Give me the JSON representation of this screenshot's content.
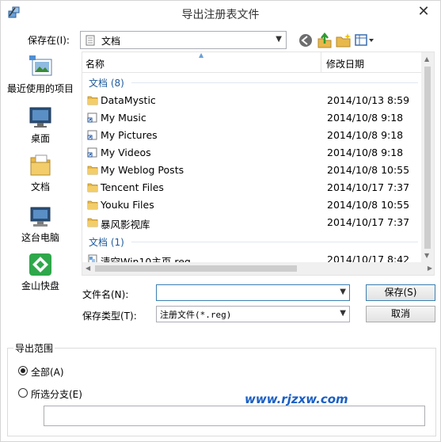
{
  "window": {
    "title": "导出注册表文件",
    "close_glyph": "✕"
  },
  "toolbar": {
    "save_in_label": "保存在(I):",
    "location": "文档",
    "back_icon": "back-arrow-icon",
    "up_icon": "up-folder-icon",
    "new_folder_icon": "new-folder-icon",
    "view_icon": "view-menu-icon"
  },
  "places": [
    {
      "label": "最近使用的项目",
      "icon": "recent-items-icon"
    },
    {
      "label": "桌面",
      "icon": "desktop-icon"
    },
    {
      "label": "文档",
      "icon": "documents-icon"
    },
    {
      "label": "这台电脑",
      "icon": "this-pc-icon"
    },
    {
      "label": "金山快盘",
      "icon": "kuaipan-icon"
    }
  ],
  "filelist": {
    "columns": {
      "name": "名称",
      "date": "修改日期"
    },
    "groups": [
      {
        "label": "文档 (8)"
      },
      {
        "label": "文档 (1)"
      }
    ],
    "rows": [
      {
        "name": "DataMystic",
        "date": "2014/10/13 8:59",
        "icon": "folder-icon"
      },
      {
        "name": "My Music",
        "date": "2014/10/8 9:18",
        "icon": "shortcut-icon"
      },
      {
        "name": "My Pictures",
        "date": "2014/10/8 9:18",
        "icon": "shortcut-icon"
      },
      {
        "name": "My Videos",
        "date": "2014/10/8 9:18",
        "icon": "shortcut-icon"
      },
      {
        "name": "My Weblog Posts",
        "date": "2014/10/8 10:55",
        "icon": "folder-icon"
      },
      {
        "name": "Tencent Files",
        "date": "2014/10/17 7:37",
        "icon": "folder-icon"
      },
      {
        "name": "Youku Files",
        "date": "2014/10/8 10:55",
        "icon": "folder-icon"
      },
      {
        "name": "暴风影视库",
        "date": "2014/10/17 7:37",
        "icon": "folder-icon"
      },
      {
        "name": "清空Win10主页.reg",
        "date": "2014/10/17 8:42",
        "icon": "reg-file-icon"
      }
    ]
  },
  "form": {
    "filename_label": "文件名(N):",
    "filename_value": "",
    "filetype_label": "保存类型(T):",
    "filetype_value": "注册文件(*.reg)",
    "save_button": "保存(S)",
    "cancel_button": "取消"
  },
  "export_range": {
    "title": "导出范围",
    "options": [
      {
        "label": "全部(A)",
        "selected": true
      },
      {
        "label": "所选分支(E)",
        "selected": false
      }
    ],
    "branch_value": ""
  },
  "watermark": "www.rjzxw.com",
  "colors": {
    "group_header": "#1e5a9a",
    "accent": "#3c7fb1",
    "folder": "#e8b84a",
    "watermark": "#1a5fc4"
  }
}
